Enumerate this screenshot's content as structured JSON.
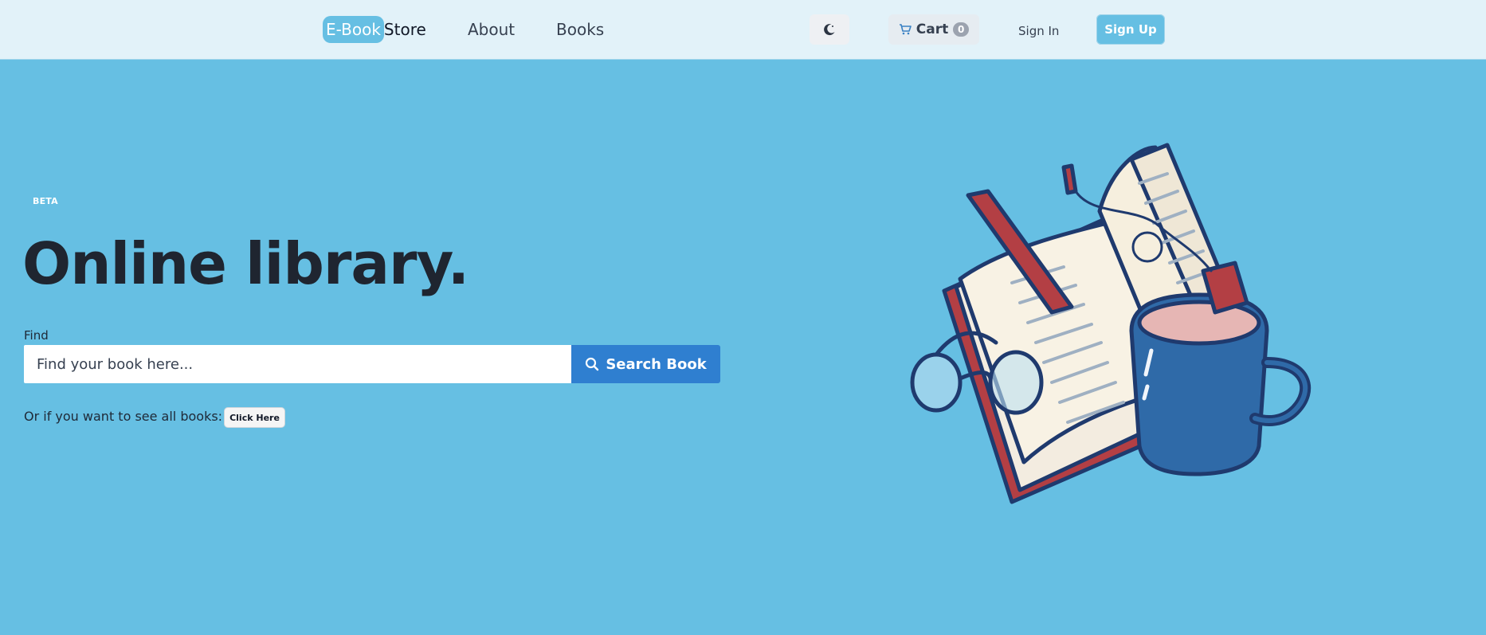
{
  "nav": {
    "brand_highlight": "E-Book",
    "brand_rest": "Store",
    "links": [
      "About",
      "Books"
    ],
    "theme_icon": "moon-icon",
    "cart_label": "Cart",
    "cart_count": "0",
    "cart_icon": "cart-icon",
    "sign_in": "Sign In",
    "sign_up": "Sign Up"
  },
  "hero": {
    "badge": "BETA",
    "title": "Online library.",
    "find_label": "Find",
    "search_placeholder": "Find your book here...",
    "search_button": "Search Book",
    "search_icon": "search-icon",
    "all_books_text": "Or if you want to see all books:",
    "click_here": "Click Here"
  },
  "colors": {
    "background": "#66bfe3",
    "navbar": "#e2f2f9",
    "primary_button": "#2f7fd0",
    "accent": "#66bfe3"
  }
}
